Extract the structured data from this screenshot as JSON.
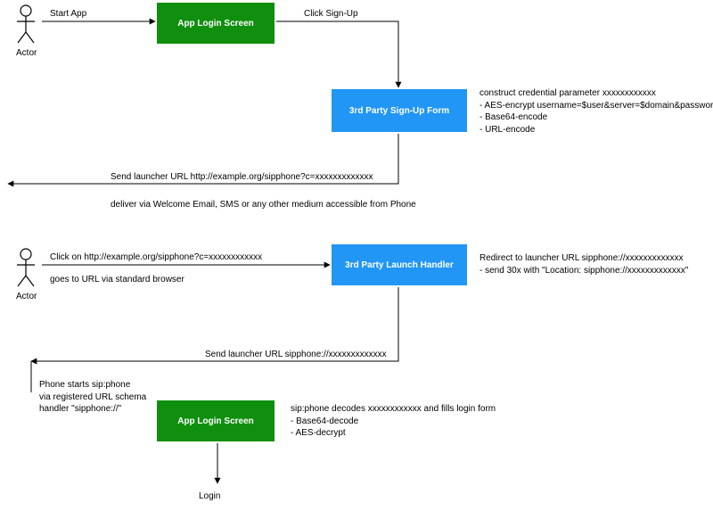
{
  "actors": {
    "top": {
      "label": "Actor"
    },
    "bottom": {
      "label": "Actor"
    }
  },
  "boxes": {
    "login1": {
      "label": "App Login Screen"
    },
    "signup": {
      "label": "3rd Party Sign-Up Form"
    },
    "launcher": {
      "label": "3rd Party Launch Handler"
    },
    "login2": {
      "label": "App Login Screen"
    }
  },
  "labels": {
    "startApp": "Start App",
    "clickSignUp": "Click Sign-Up",
    "construct": "construct credential parameter xxxxxxxxxxxx\n- AES-encrypt username=$user&server=$domain&password=$pass\n- Base64-encode\n- URL-encode",
    "sendUrl1": "Send launcher URL http://example.org/sipphone?c=xxxxxxxxxxxxx",
    "deliver": "deliver via Welcome Email, SMS or any other medium accessible from Phone",
    "clickOn": "Click on http://example.org/sipphone?c=xxxxxxxxxxxx",
    "goesTo": "goes to URL via standard browser",
    "redirect": "Redirect to launcher URL sipphone://xxxxxxxxxxxxx\n- send 30x with \"Location: sipphone://xxxxxxxxxxxxx\"",
    "sendUrl2": "Send launcher URL sipphone://xxxxxxxxxxxxx",
    "phoneStarts": "Phone starts sip:phone\nvia registered URL schema\nhandler \"sipphone://\"",
    "decodes": "sip:phone decodes xxxxxxxxxxxx and fills login form\n- Base64-decode\n- AES-decrypt",
    "login": "Login"
  }
}
